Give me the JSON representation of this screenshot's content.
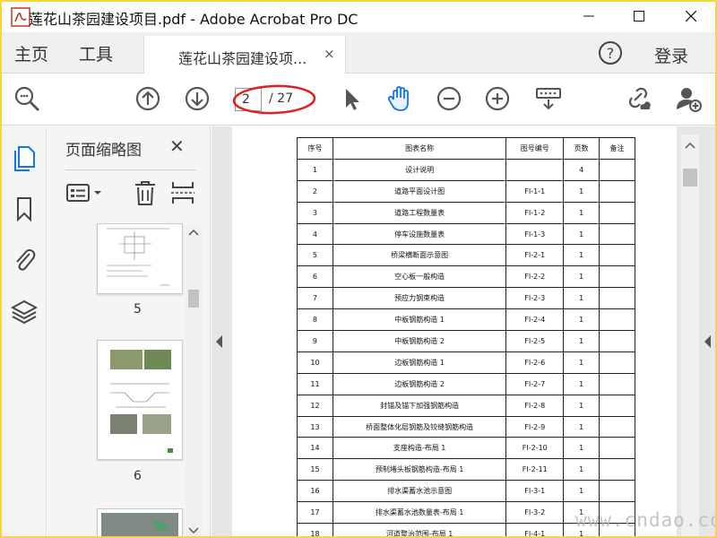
{
  "window": {
    "title": "莲花山茶园建设项目.pdf - Adobe Acrobat Pro DC",
    "min_icon": "minimize-icon",
    "max_icon": "maximize-icon",
    "close_icon": "close-icon"
  },
  "tabs": {
    "home": "主页",
    "tools": "工具",
    "document": "莲花山茶园建设项...",
    "document_close": "×",
    "login": "登录"
  },
  "toolbar": {
    "current_page": "2",
    "total_pages": "/ 27",
    "accent_color": "#1473e6",
    "annotation_color": "#e02020"
  },
  "thumbnails_pane": {
    "title": "页面缩略图",
    "close": "✕",
    "pages": [
      {
        "number": "5"
      },
      {
        "number": "6"
      }
    ]
  },
  "table": {
    "headers": [
      "序号",
      "图表名称",
      "图号编号",
      "页数",
      "备注"
    ],
    "rows": [
      [
        "1",
        "设计说明",
        "",
        "4",
        ""
      ],
      [
        "2",
        "道路平面设计图",
        "FI-1-1",
        "1",
        ""
      ],
      [
        "3",
        "道路工程数量表",
        "FI-1-2",
        "1",
        ""
      ],
      [
        "4",
        "停车设施数量表",
        "FI-1-3",
        "1",
        ""
      ],
      [
        "5",
        "桥梁横断面示意图",
        "FI-2-1",
        "1",
        ""
      ],
      [
        "6",
        "空心板一般构造",
        "FI-2-2",
        "1",
        ""
      ],
      [
        "7",
        "预应力钢束构造",
        "FI-2-3",
        "1",
        ""
      ],
      [
        "8",
        "中板钢筋构造 1",
        "FI-2-4",
        "1",
        ""
      ],
      [
        "9",
        "中板钢筋构造 2",
        "FI-2-5",
        "1",
        ""
      ],
      [
        "10",
        "边板钢筋构造 1",
        "FI-2-6",
        "1",
        ""
      ],
      [
        "11",
        "边板钢筋构造 2",
        "FI-2-7",
        "1",
        ""
      ],
      [
        "12",
        "封锚及锚下加强钢筋构造",
        "FI-2-8",
        "1",
        ""
      ],
      [
        "13",
        "桥面整体化层钢筋及铰缝钢筋构造",
        "FI-2-9",
        "1",
        ""
      ],
      [
        "14",
        "支座构造-布局 1",
        "FI-2-10",
        "1",
        ""
      ],
      [
        "15",
        "预制堵头板钢筋构造-布局 1",
        "FI-2-11",
        "1",
        ""
      ],
      [
        "16",
        "排水渠蓄水池示意图",
        "FI-3-1",
        "1",
        ""
      ],
      [
        "17",
        "排水渠蓄水池数量表-布局 1",
        "FI-3-2",
        "1",
        ""
      ],
      [
        "18",
        "河道整治范围-布局 1",
        "FI-4-1",
        "1",
        ""
      ]
    ]
  },
  "watermark": "www.cndao.com"
}
